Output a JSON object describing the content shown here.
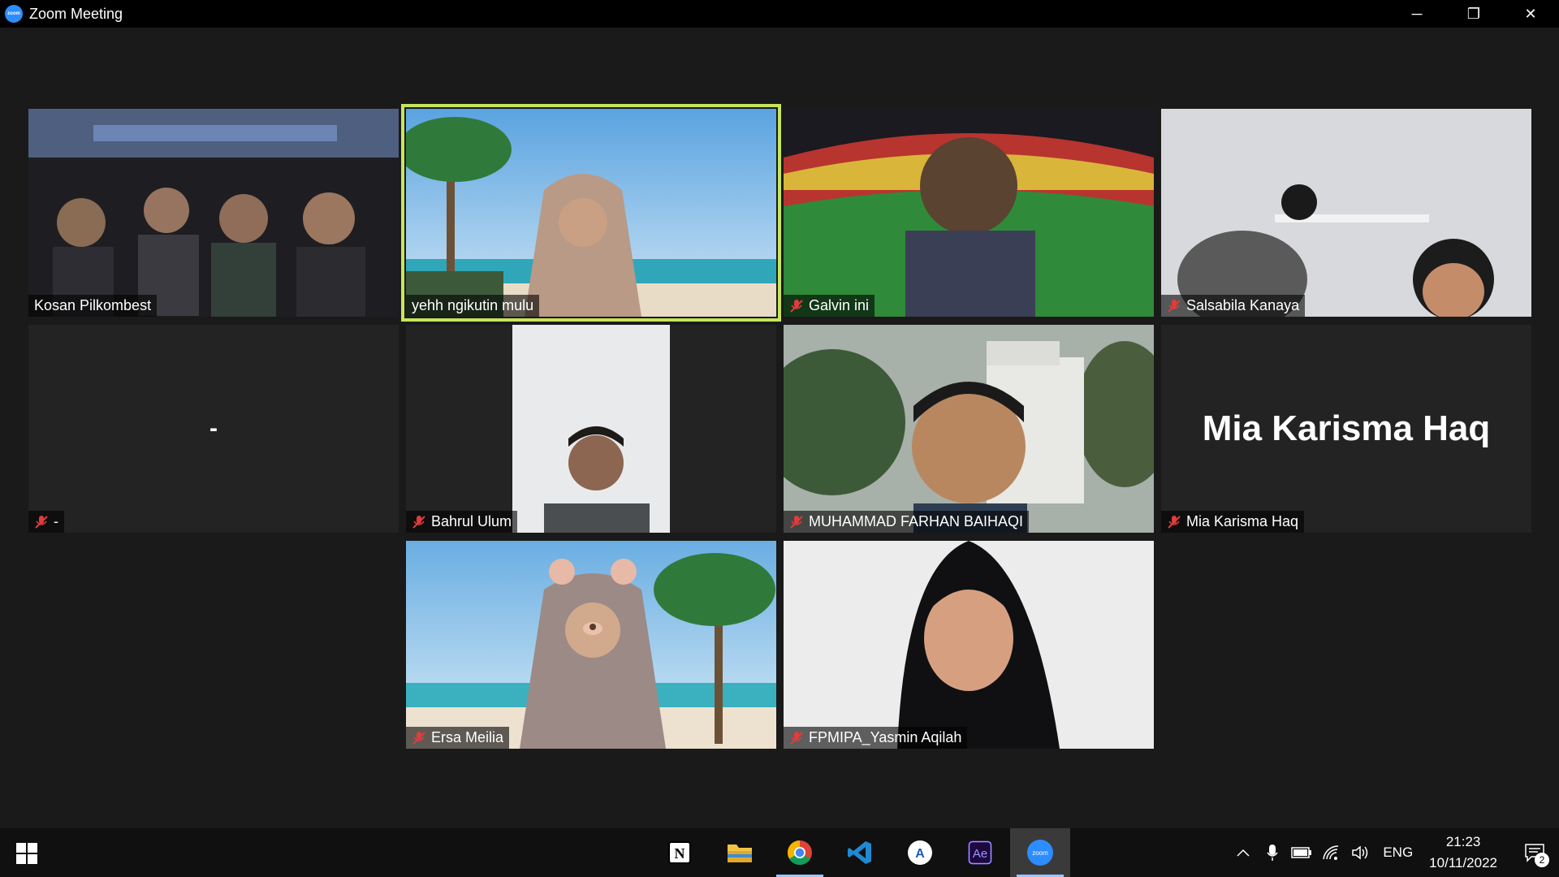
{
  "window": {
    "app_icon_text": "zoom",
    "title": "Zoom Meeting",
    "controls": {
      "minimize": "─",
      "restore": "❐",
      "close": "✕"
    }
  },
  "gallery": {
    "active_speaker_color": "#c7e55a",
    "participants": [
      {
        "name": "Kosan Pilkombest",
        "muted": false,
        "video": true,
        "active": false
      },
      {
        "name": "yehh ngikutin mulu",
        "muted": false,
        "video": true,
        "active": true
      },
      {
        "name": "Galvin ini",
        "muted": true,
        "video": true,
        "active": false
      },
      {
        "name": "Salsabila Kanaya",
        "muted": true,
        "video": true,
        "active": false
      },
      {
        "name": "-",
        "muted": true,
        "video": false,
        "placeholder": "-",
        "active": false
      },
      {
        "name": "Bahrul Ulum",
        "muted": true,
        "video": true,
        "active": false
      },
      {
        "name": "MUHAMMAD FARHAN BAIHAQI",
        "muted": true,
        "video": true,
        "active": false
      },
      {
        "name": "Mia Karisma Haq",
        "muted": true,
        "video": false,
        "placeholder": "Mia Karisma Haq",
        "active": false
      },
      {
        "name": "Ersa Meilia",
        "muted": true,
        "video": true,
        "active": false
      },
      {
        "name": "FPMIPA_Yasmin Aqilah",
        "muted": true,
        "video": true,
        "active": false
      }
    ]
  },
  "taskbar": {
    "pinned": [
      {
        "icon": "notion-icon",
        "glyph": "N",
        "running": false
      },
      {
        "icon": "file-explorer-icon",
        "glyph": "",
        "running": false
      },
      {
        "icon": "chrome-icon",
        "glyph": "",
        "running": true
      },
      {
        "icon": "vscode-icon",
        "glyph": "",
        "running": false
      },
      {
        "icon": "app-a-icon",
        "glyph": "A",
        "running": false
      },
      {
        "icon": "after-effects-icon",
        "glyph": "Ae",
        "running": false
      },
      {
        "icon": "zoom-icon",
        "glyph": "zoom",
        "running": true,
        "active": true
      }
    ],
    "tray": {
      "language": "ENG",
      "time": "21:23",
      "date": "10/11/2022",
      "notification_count": "2"
    }
  }
}
